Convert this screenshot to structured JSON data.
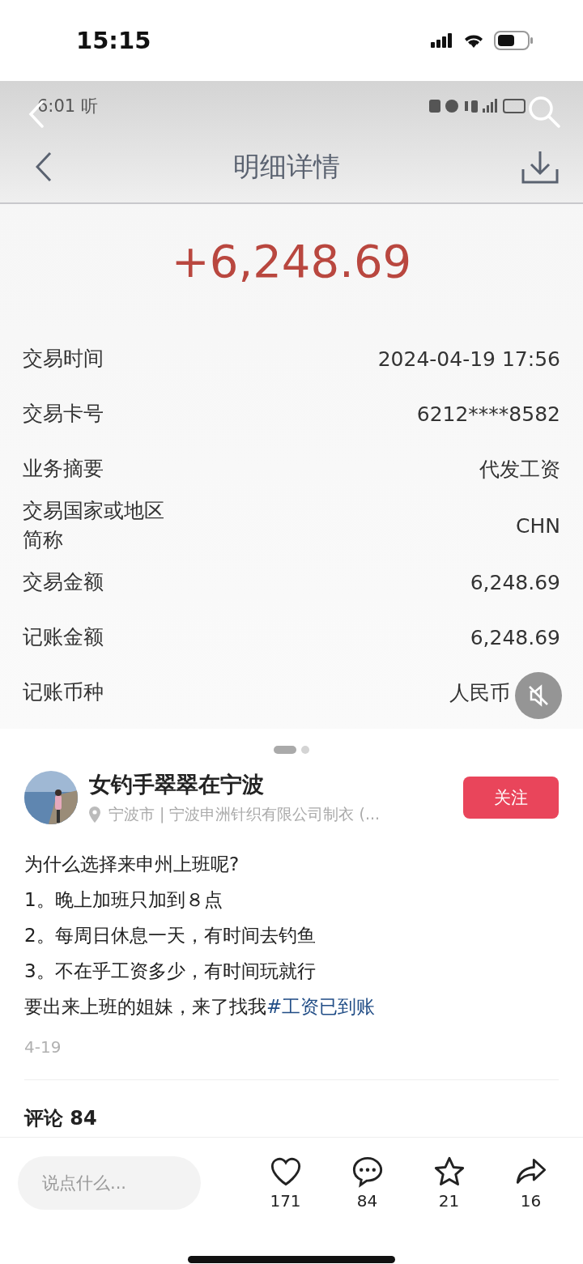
{
  "status_bar": {
    "time": "15:15"
  },
  "post_image": {
    "inner_status_time": "6:01 听",
    "title": "明细详情",
    "amount": "+6,248.69",
    "details": [
      {
        "label": "交易时间",
        "value": "2024-04-19 17:56"
      },
      {
        "label": "交易卡号",
        "value": "6212****8582"
      },
      {
        "label": "业务摘要",
        "value": "代发工资"
      },
      {
        "label": "交易国家或地区",
        "label_cont": "简称",
        "value": "CHN"
      },
      {
        "label": "交易金额",
        "value": "6,248.69"
      },
      {
        "label": "记账金额",
        "value": "6,248.69"
      },
      {
        "label": "记账币种",
        "value": "人民币"
      }
    ],
    "muted": true
  },
  "carousel": [
    {
      "selected": true
    },
    {
      "selected": false
    }
  ],
  "author": {
    "name": "女钓手翠翠在宁波",
    "location": "宁波市 | 宁波申洲针织有限公司制衣 (...",
    "follow": "关注"
  },
  "body": [
    "为什么选择来申州上班呢?",
    "1。晚上加班只加到８点",
    "2。每周日休息一天，有时间去钓鱼",
    "3。不在乎工资多少，有时间玩就行",
    "要出来上班的姐妹，来了找我"
  ],
  "hashtag": "#工资已到账",
  "date": "4-19",
  "comments_header": "评论 84",
  "bottom_bar": {
    "placeholder": "说点什么...",
    "actions": [
      {
        "kind": "like",
        "count": "171"
      },
      {
        "kind": "comment",
        "count": "84"
      },
      {
        "kind": "collect",
        "count": "21"
      },
      {
        "kind": "share",
        "count": "16"
      }
    ]
  }
}
